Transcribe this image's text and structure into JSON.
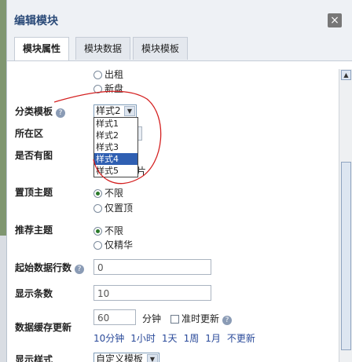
{
  "dialog": {
    "title": "编辑模块",
    "close_label": "×"
  },
  "tabs": [
    {
      "label": "模块属性",
      "active": true
    },
    {
      "label": "模块数据",
      "active": false
    },
    {
      "label": "模块模板",
      "active": false
    }
  ],
  "status_options": [
    "出租",
    "新盘"
  ],
  "category_template": {
    "label": "分类模板",
    "selected": "样式2",
    "options": [
      "样式1",
      "样式2",
      "样式3",
      "样式4",
      "样式5"
    ],
    "highlighted": "样式4"
  },
  "region": {
    "label": "所在区"
  },
  "has_image": {
    "label": "是否有图",
    "partial_suffix": "片"
  },
  "pinned": {
    "label": "置顶主题",
    "options": [
      "不限",
      "仅置顶"
    ],
    "selected": "不限"
  },
  "recommended": {
    "label": "推荐主题",
    "options": [
      "不限",
      "仅精华"
    ],
    "selected": "不限"
  },
  "start_row": {
    "label": "起始数据行数",
    "value": "0"
  },
  "display_count": {
    "label": "显示条数",
    "value": "10"
  },
  "cache": {
    "label": "数据缓存更新",
    "value": "60",
    "unit": "分钟",
    "realtime_label": "准时更新",
    "quick_links": [
      "10分钟",
      "1小时",
      "1天",
      "1周",
      "1月",
      "不更新"
    ]
  },
  "display_style": {
    "label": "显示样式",
    "value": "自定义模板"
  },
  "colors": {
    "title": "#2a4a78",
    "highlight": "#2f5fb2",
    "annotation": "#d42020"
  }
}
